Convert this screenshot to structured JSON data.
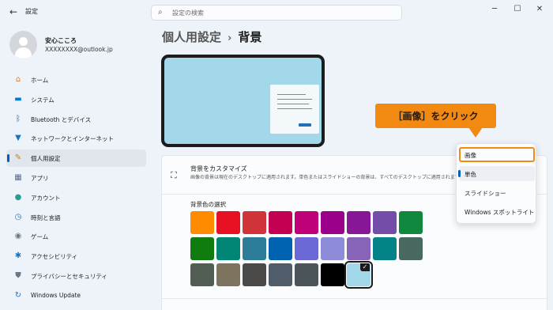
{
  "window": {
    "title": "設定",
    "back_icon": "←",
    "controls": {
      "minimize": "─",
      "maximize": "☐",
      "close": "✕"
    }
  },
  "search": {
    "placeholder": "設定の検索",
    "icon": "⌕"
  },
  "profile": {
    "name": "安心こころ",
    "email": "XXXXXXXX@outlook.jp"
  },
  "sidebar": {
    "items": [
      {
        "label": "ホーム",
        "icon": "⌂",
        "icon_name": "home-icon",
        "color": "#d97a2b"
      },
      {
        "label": "システム",
        "icon": "▬",
        "icon_name": "system-icon",
        "color": "#0078d4"
      },
      {
        "label": "Bluetooth とデバイス",
        "icon": "ᛒ",
        "icon_name": "bluetooth-icon",
        "color": "#0067c0"
      },
      {
        "label": "ネットワークとインターネット",
        "icon": "▼",
        "icon_name": "wifi-icon",
        "color": "#1a73c9"
      },
      {
        "label": "個人用設定",
        "icon": "✎",
        "icon_name": "brush-icon",
        "color": "#c97a1f",
        "active": true
      },
      {
        "label": "アプリ",
        "icon": "▦",
        "icon_name": "apps-icon",
        "color": "#5a6e8a"
      },
      {
        "label": "アカウント",
        "icon": "●",
        "icon_name": "account-icon",
        "color": "#2a9d8f"
      },
      {
        "label": "時刻と言語",
        "icon": "◷",
        "icon_name": "time-language-icon",
        "color": "#1a73c9"
      },
      {
        "label": "ゲーム",
        "icon": "◉",
        "icon_name": "gaming-icon",
        "color": "#6b7785"
      },
      {
        "label": "アクセシビリティ",
        "icon": "✱",
        "icon_name": "accessibility-icon",
        "color": "#1a73c9"
      },
      {
        "label": "プライバシーとセキュリティ",
        "icon": "⛊",
        "icon_name": "shield-icon",
        "color": "#6b7785"
      },
      {
        "label": "Windows Update",
        "icon": "↻",
        "icon_name": "update-icon",
        "color": "#1a73c9"
      }
    ]
  },
  "breadcrumb": {
    "parent": "個人用設定",
    "separator": "›",
    "current": "背景"
  },
  "background_card": {
    "icon": "⛶",
    "title": "背景をカスタマイズ",
    "description": "画像の背景は現在のデスクトップに適用されます。単色またはスライドショーの背景は、すべてのデスクトップに適用されます。",
    "color_label": "背景色の選択",
    "swatches": [
      [
        "#ff8c00",
        "#e81123",
        "#d13438",
        "#c30052",
        "#bf0077",
        "#9a0089",
        "#881798",
        "#744da9",
        "#10893e"
      ],
      [
        "#107c10",
        "#018574",
        "#2d7d9a",
        "#0063b1",
        "#6b69d6",
        "#8e8cd8",
        "#8764b8",
        "#038387",
        "#486860"
      ],
      [
        "#525e54",
        "#7e735f",
        "#4c4a48",
        "#515c6b",
        "#4a5459",
        "#000000",
        "#a3d8ea"
      ]
    ],
    "selected_swatch": "#a3d8ea",
    "check": "✓"
  },
  "callout": {
    "text": "［画像］をクリック",
    "color": "#f28a12"
  },
  "dropdown": {
    "options": [
      "画像",
      "単色",
      "スライドショー",
      "Windows スポットライト"
    ],
    "selected": "単色",
    "highlighted": "画像"
  }
}
